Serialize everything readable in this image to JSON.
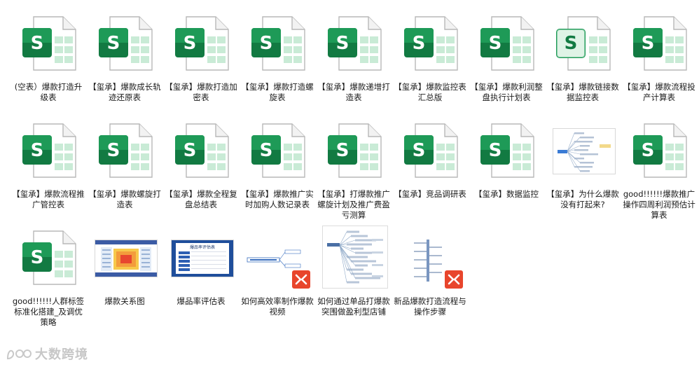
{
  "colors": {
    "excel_dark": "#127A42",
    "excel_mid": "#1E9A57",
    "excel_light": "#C9EBD6",
    "video_badge": "#E8452C"
  },
  "files": [
    {
      "name": "(空表）爆款打造升级表",
      "type": "excel",
      "icon": "excel-file-icon"
    },
    {
      "name": "【玺承】爆款成长轨迹还原表",
      "type": "excel",
      "icon": "excel-file-icon"
    },
    {
      "name": "【玺承】爆款打造加密表",
      "type": "excel",
      "icon": "excel-file-icon"
    },
    {
      "name": "【玺承】爆款打造螺旋表",
      "type": "excel",
      "icon": "excel-file-icon"
    },
    {
      "name": "【玺承】爆款递增打造表",
      "type": "excel",
      "icon": "excel-file-icon"
    },
    {
      "name": "【玺承】爆款监控表 汇总版",
      "type": "excel",
      "icon": "excel-file-icon"
    },
    {
      "name": "【玺承】爆款利润整盘执行计划表",
      "type": "excel",
      "icon": "excel-file-icon"
    },
    {
      "name": "【玺承】爆款链接数据监控表",
      "type": "excel-preview",
      "icon": "excel-file-icon"
    },
    {
      "name": "【玺承】爆款流程投产计算表",
      "type": "excel",
      "icon": "excel-file-icon"
    },
    {
      "name": "【玺承】爆款流程推广管控表",
      "type": "excel",
      "icon": "excel-file-icon"
    },
    {
      "name": "【玺承】爆款螺旋打造表",
      "type": "excel",
      "icon": "excel-file-icon"
    },
    {
      "name": "【玺承】爆款全程复盘总结表",
      "type": "excel",
      "icon": "excel-file-icon"
    },
    {
      "name": "【玺承】爆款推广实时加购人数记录表",
      "type": "excel",
      "icon": "excel-file-icon"
    },
    {
      "name": "【玺承】打爆款推广螺旋计划及推广费盈亏测算",
      "type": "excel",
      "icon": "excel-file-icon"
    },
    {
      "name": "【玺承】竞品调研表",
      "type": "excel",
      "icon": "excel-file-icon"
    },
    {
      "name": "【玺承】数据监控",
      "type": "excel",
      "icon": "excel-file-icon"
    },
    {
      "name": "【玺承】为什么爆款没有打起来?",
      "type": "mindmap",
      "icon": "mindmap-thumbnail-icon"
    },
    {
      "name": "good!!!!!!爆款推广操作四周利润预估计算表",
      "type": "excel",
      "icon": "excel-file-icon"
    },
    {
      "name": "good!!!!!!人群标签标准化搭建_及调优策略",
      "type": "excel",
      "icon": "excel-file-icon"
    },
    {
      "name": "爆款关系图",
      "type": "chart-image",
      "icon": "chart-image-thumbnail-icon"
    },
    {
      "name": "爆品率评估表",
      "type": "table-image",
      "icon": "table-image-thumbnail-icon",
      "thumb_title": "爆品率评估表"
    },
    {
      "name": "如何高效率制作爆款视频",
      "type": "xmind-flow",
      "icon": "xmind-file-icon"
    },
    {
      "name": "如何通过单品打爆款突围做盈利型店铺",
      "type": "mindmap-tall",
      "icon": "mindmap-thumbnail-icon"
    },
    {
      "name": "新品爆款打造流程与操作步骤",
      "type": "xmind-tree",
      "icon": "xmind-file-icon"
    }
  ],
  "watermark": {
    "text": "大数跨境"
  }
}
